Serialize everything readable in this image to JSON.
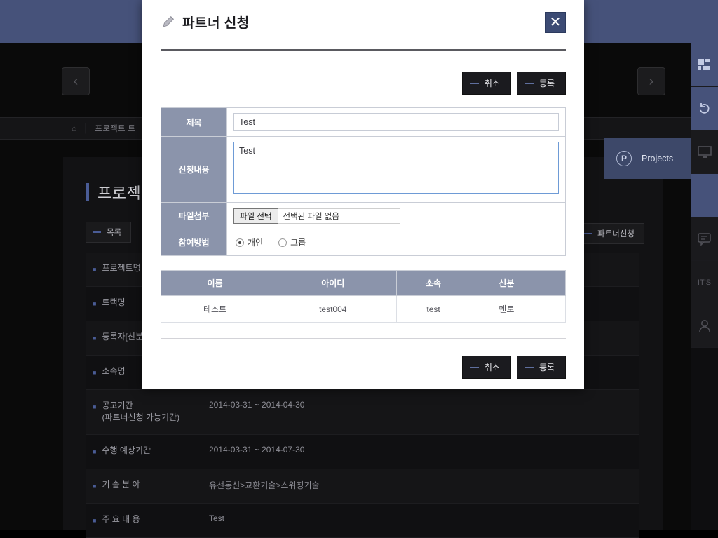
{
  "background": {
    "breadcrumb": {
      "home_icon": "home-icon",
      "text": "프로젝트 트"
    },
    "nav": {
      "prev": "‹",
      "next": "›"
    },
    "page_title": "프로젝",
    "list_button": "목록",
    "partner_button": "파트너신청",
    "detail_rows": [
      {
        "label": "프로젝트명",
        "value": ""
      },
      {
        "label": "트랙명",
        "value": ""
      },
      {
        "label": "등록자[신분]",
        "value": ""
      },
      {
        "label": "소속명",
        "value": ""
      },
      {
        "label": "공고기간\n(파트너신청 가능기간)",
        "label_line1": "공고기간",
        "label_line2": "(파트너신청 가능기간)",
        "value": "2014-03-31 ~ 2014-04-30"
      },
      {
        "label": "수행 예상기간",
        "value": "2014-03-31 ~ 2014-07-30"
      },
      {
        "label": "기 술 분 야",
        "value": "유선통신>교환기술>스위칭기술"
      },
      {
        "label": "주 요 내 용",
        "value": "Test"
      }
    ],
    "rail": [
      {
        "icon": "grid-icon",
        "style": "accent"
      },
      {
        "icon": "undo-icon",
        "style": "accent"
      },
      {
        "icon": "monitor-icon",
        "style": "dark"
      },
      {
        "icon": "projects-icon",
        "style": "accent"
      },
      {
        "icon": "chat-icon",
        "style": "dark"
      },
      {
        "icon": "its-label",
        "label": "IT'S",
        "style": "dark"
      },
      {
        "icon": "person-icon",
        "style": "dark"
      }
    ],
    "flyout": {
      "icon": "projects-circle-p-icon",
      "label": "Projects"
    }
  },
  "modal": {
    "title": "파트너 신청",
    "title_icon": "pencil-icon",
    "close_label": "✕",
    "buttons": {
      "cancel": "취소",
      "submit": "등록"
    },
    "form": {
      "title_label": "제목",
      "title_value": "Test",
      "content_label": "신청내용",
      "content_value": "Test",
      "file_label": "파일첨부",
      "file_button": "파일 선택",
      "file_status": "선택된 파일 없음",
      "join_label": "참여방법",
      "join_options": [
        {
          "label": "개인",
          "selected": true
        },
        {
          "label": "그룹",
          "selected": false
        }
      ]
    },
    "table": {
      "headers": [
        "이름",
        "아이디",
        "소속",
        "신분"
      ],
      "rows": [
        [
          "테스트",
          "test004",
          "test",
          "멘토"
        ]
      ]
    }
  },
  "colors": {
    "accent_blue": "#46527a",
    "label_cell": "#8b94ab",
    "focus_border": "#6e9bd6",
    "dark_panel": "#121214"
  }
}
